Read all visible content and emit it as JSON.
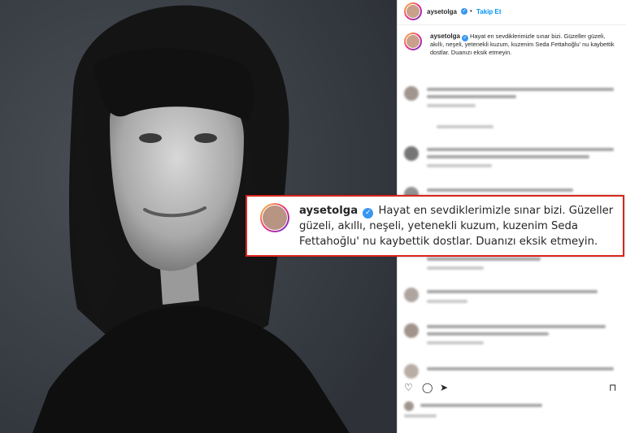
{
  "post": {
    "username": "aysetolga",
    "follow_label": "Takip Et",
    "more_label": "•••",
    "verified_glyph": "✓",
    "caption": "Hayat en sevdiklerimizle sınar bizi. Güzeller güzeli, akıllı, neşeli, yetenekli kuzum, kuzenim Seda Fettahoğlu' nu kaybettik dostlar. Duanızı eksik etmeyin."
  },
  "callout": {
    "username": "aysetolga",
    "caption": "Hayat en sevdiklerimizle sınar bizi. Güzeller güzeli, akıllı, neşeli, yetenekli kuzum, kuzenim Seda Fettahoğlu' nu kaybettik dostlar. Duanızı eksik etmeyin."
  },
  "icons": {
    "like": "♡",
    "comment": "◯",
    "share": "➤",
    "save": "⊓"
  },
  "colors": {
    "accent": "#0095f6",
    "verified": "#3897f0",
    "callout_border": "#d9261c",
    "photo_bg": "#3a3e45"
  }
}
